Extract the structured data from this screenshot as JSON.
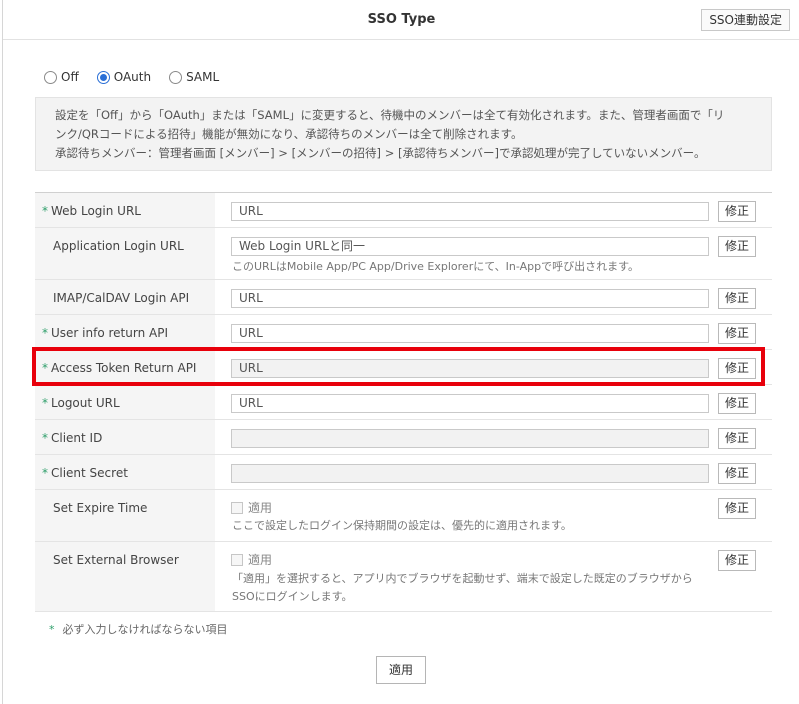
{
  "header": {
    "title": "SSO Type",
    "settings_button": "SSO連動設定"
  },
  "sso_type": {
    "options": [
      {
        "label": "Off",
        "selected": false
      },
      {
        "label": "OAuth",
        "selected": true
      },
      {
        "label": "SAML",
        "selected": false
      }
    ]
  },
  "notice": {
    "line1": "設定を「Off」から「OAuth」または「SAML」に変更すると、待機中のメンバーは全て有効化されます。また、管理者画面で「リ",
    "line2": "ンク/QRコードによる招待」機能が無効になり、承認待ちのメンバーは全て削除されます。",
    "line3": "承認待ちメンバー：管理者画面 [メンバー] > [メンバーの招待] > [承認待ちメンバー]で承認処理が完了していないメンバー。"
  },
  "required_mark": "*",
  "edit_label": "修正",
  "fields": [
    {
      "label": "Web Login URL",
      "required": true,
      "value": "URL"
    },
    {
      "label": "Application Login URL",
      "required": false,
      "value": "Web Login URLと同一",
      "hint": "このURLはMobile App/PC App/Drive Explorerにて、In-Appで呼び出されます。"
    },
    {
      "label": "IMAP/CalDAV Login API",
      "required": false,
      "value": "URL"
    },
    {
      "label": "User info return API",
      "required": true,
      "value": "URL"
    },
    {
      "label": "Access Token Return API",
      "required": true,
      "value": "URL"
    },
    {
      "label": "Logout URL",
      "required": true,
      "value": "URL"
    },
    {
      "label": "Client ID",
      "required": true,
      "value": ""
    },
    {
      "label": "Client Secret",
      "required": true,
      "value": ""
    },
    {
      "label": "Set Expire Time",
      "required": false,
      "checkbox_label": "適用",
      "checked": false,
      "hint": "ここで設定したログイン保持期間の設定は、優先的に適用されます。"
    },
    {
      "label": "Set External Browser",
      "required": false,
      "checkbox_label": "適用",
      "checked": false,
      "hint_line1": "「適用」を選択すると、アプリ内でブラウザを起動せず、端末で設定した既定のブラウザから",
      "hint_line2": "SSOにログインします。"
    }
  ],
  "footnote": "必ず入力しなければならない項目",
  "apply_button": "適用",
  "colors": {
    "accent": "#2a6fd6",
    "required": "#2e9e6a",
    "highlight": "#e8000b"
  }
}
